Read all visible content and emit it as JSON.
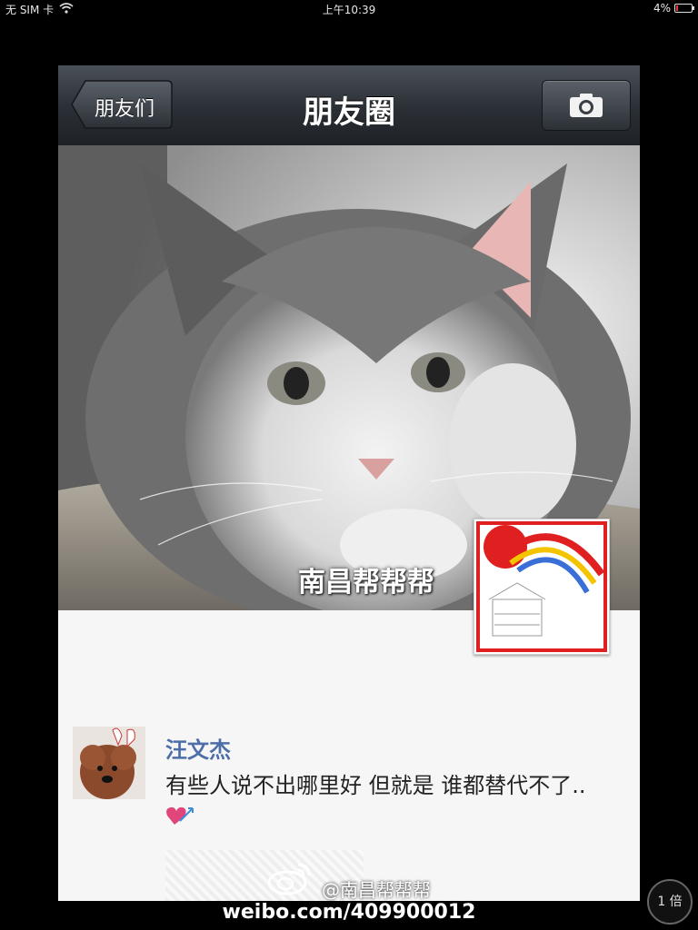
{
  "status_bar": {
    "carrier": "无 SIM 卡",
    "time": "上午10:39",
    "battery": "4%"
  },
  "nav": {
    "back_label": "朋友们",
    "title": "朋友圈"
  },
  "cover": {
    "name": "南昌帮帮帮"
  },
  "post": {
    "username": "汪文杰",
    "text": "有些人说不出哪里好 但就是 谁都替代不了.."
  },
  "watermark": {
    "handle": "@南昌帮帮帮",
    "url": "weibo.com/409900012"
  },
  "zoom": {
    "label": "1 倍"
  },
  "colors": {
    "nav_bg": "#2a2f35",
    "username": "#4e6ea8",
    "heart": "#e0457b"
  },
  "icons": [
    "chevron-left-icon",
    "camera-icon",
    "wifi-icon",
    "battery-icon",
    "heart-icon",
    "weibo-icon"
  ]
}
